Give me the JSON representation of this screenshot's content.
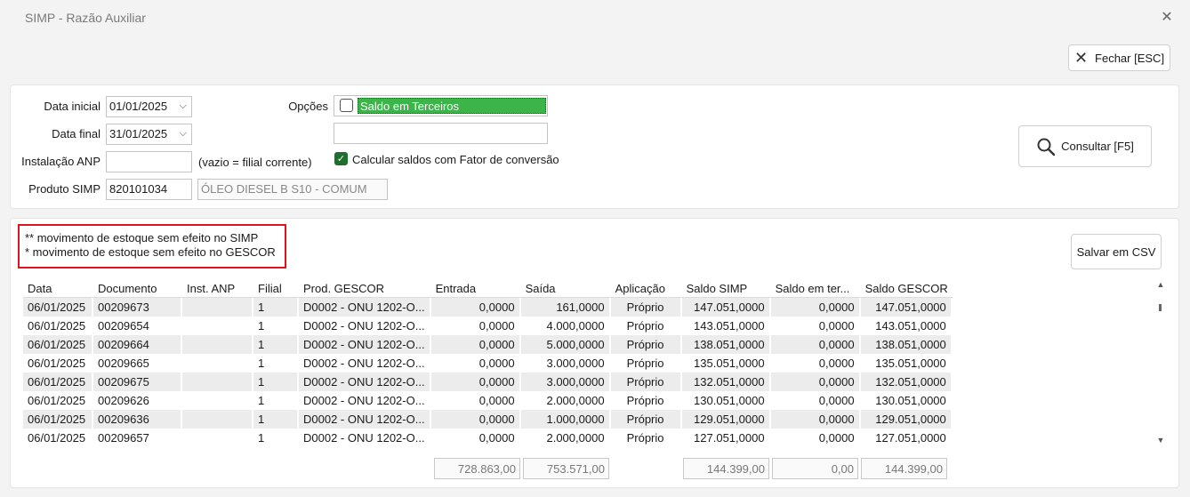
{
  "window": {
    "title": "SIMP - Razão Auxiliar"
  },
  "toolbar": {
    "close_label": "Fechar [ESC]",
    "consult_label": "Consultar [F5]",
    "csv_label": "Salvar em CSV"
  },
  "filters": {
    "data_inicial_label": "Data inicial",
    "data_inicial": "01/01/2025",
    "data_final_label": "Data final",
    "data_final": "31/01/2025",
    "instalacao_label": "Instalação ANP",
    "instalacao_value": "",
    "instalacao_hint": "(vazio = filial corrente)",
    "produto_label": "Produto SIMP",
    "produto_code": "820101034",
    "produto_desc": "ÓLEO DIESEL B S10 - COMUM",
    "opcoes_label": "Opções",
    "saldo_terceiros_label": "Saldo em Terceiros",
    "fator_label": "Calcular saldos com Fator de conversão"
  },
  "legend": {
    "line1": "** movimento de estoque sem efeito no SIMP",
    "line2": "* movimento de estoque sem efeito no GESCOR"
  },
  "grid": {
    "columns": [
      "Data",
      "Documento",
      "Inst. ANP",
      "Filial",
      "Prod. GESCOR",
      "Entrada",
      "Saída",
      "Aplicação",
      "Saldo SIMP",
      "Saldo em ter...",
      "Saldo GESCOR"
    ],
    "rows": [
      [
        "06/01/2025",
        "00209673",
        "",
        "1",
        "D0002 - ONU 1202-O...",
        "0,0000",
        "161,0000",
        "Próprio",
        "147.051,0000",
        "0,0000",
        "147.051,0000"
      ],
      [
        "06/01/2025",
        "00209654",
        "",
        "1",
        "D0002 - ONU 1202-O...",
        "0,0000",
        "4.000,0000",
        "Próprio",
        "143.051,0000",
        "0,0000",
        "143.051,0000"
      ],
      [
        "06/01/2025",
        "00209664",
        "",
        "1",
        "D0002 - ONU 1202-O...",
        "0,0000",
        "5.000,0000",
        "Próprio",
        "138.051,0000",
        "0,0000",
        "138.051,0000"
      ],
      [
        "06/01/2025",
        "00209665",
        "",
        "1",
        "D0002 - ONU 1202-O...",
        "0,0000",
        "3.000,0000",
        "Próprio",
        "135.051,0000",
        "0,0000",
        "135.051,0000"
      ],
      [
        "06/01/2025",
        "00209675",
        "",
        "1",
        "D0002 - ONU 1202-O...",
        "0,0000",
        "3.000,0000",
        "Próprio",
        "132.051,0000",
        "0,0000",
        "132.051,0000"
      ],
      [
        "06/01/2025",
        "00209626",
        "",
        "1",
        "D0002 - ONU 1202-O...",
        "0,0000",
        "2.000,0000",
        "Próprio",
        "130.051,0000",
        "0,0000",
        "130.051,0000"
      ],
      [
        "06/01/2025",
        "00209636",
        "",
        "1",
        "D0002 - ONU 1202-O...",
        "0,0000",
        "1.000,0000",
        "Próprio",
        "129.051,0000",
        "0,0000",
        "129.051,0000"
      ],
      [
        "06/01/2025",
        "00209657",
        "",
        "1",
        "D0002 - ONU 1202-O...",
        "0,0000",
        "2.000,0000",
        "Próprio",
        "127.051,0000",
        "0,0000",
        "127.051,0000"
      ]
    ]
  },
  "totals": {
    "entrada": "728.863,00",
    "saida": "753.571,00",
    "saldo_simp": "144.399,00",
    "saldo_terceiros": "0,00",
    "saldo_gescor": "144.399,00"
  },
  "icons": {
    "close": "close-icon",
    "search": "search-icon",
    "checkbox_checked_color": "#1f6e2f",
    "option_highlight_color": "#3cb44a",
    "legend_border_color": "#e0141e"
  }
}
